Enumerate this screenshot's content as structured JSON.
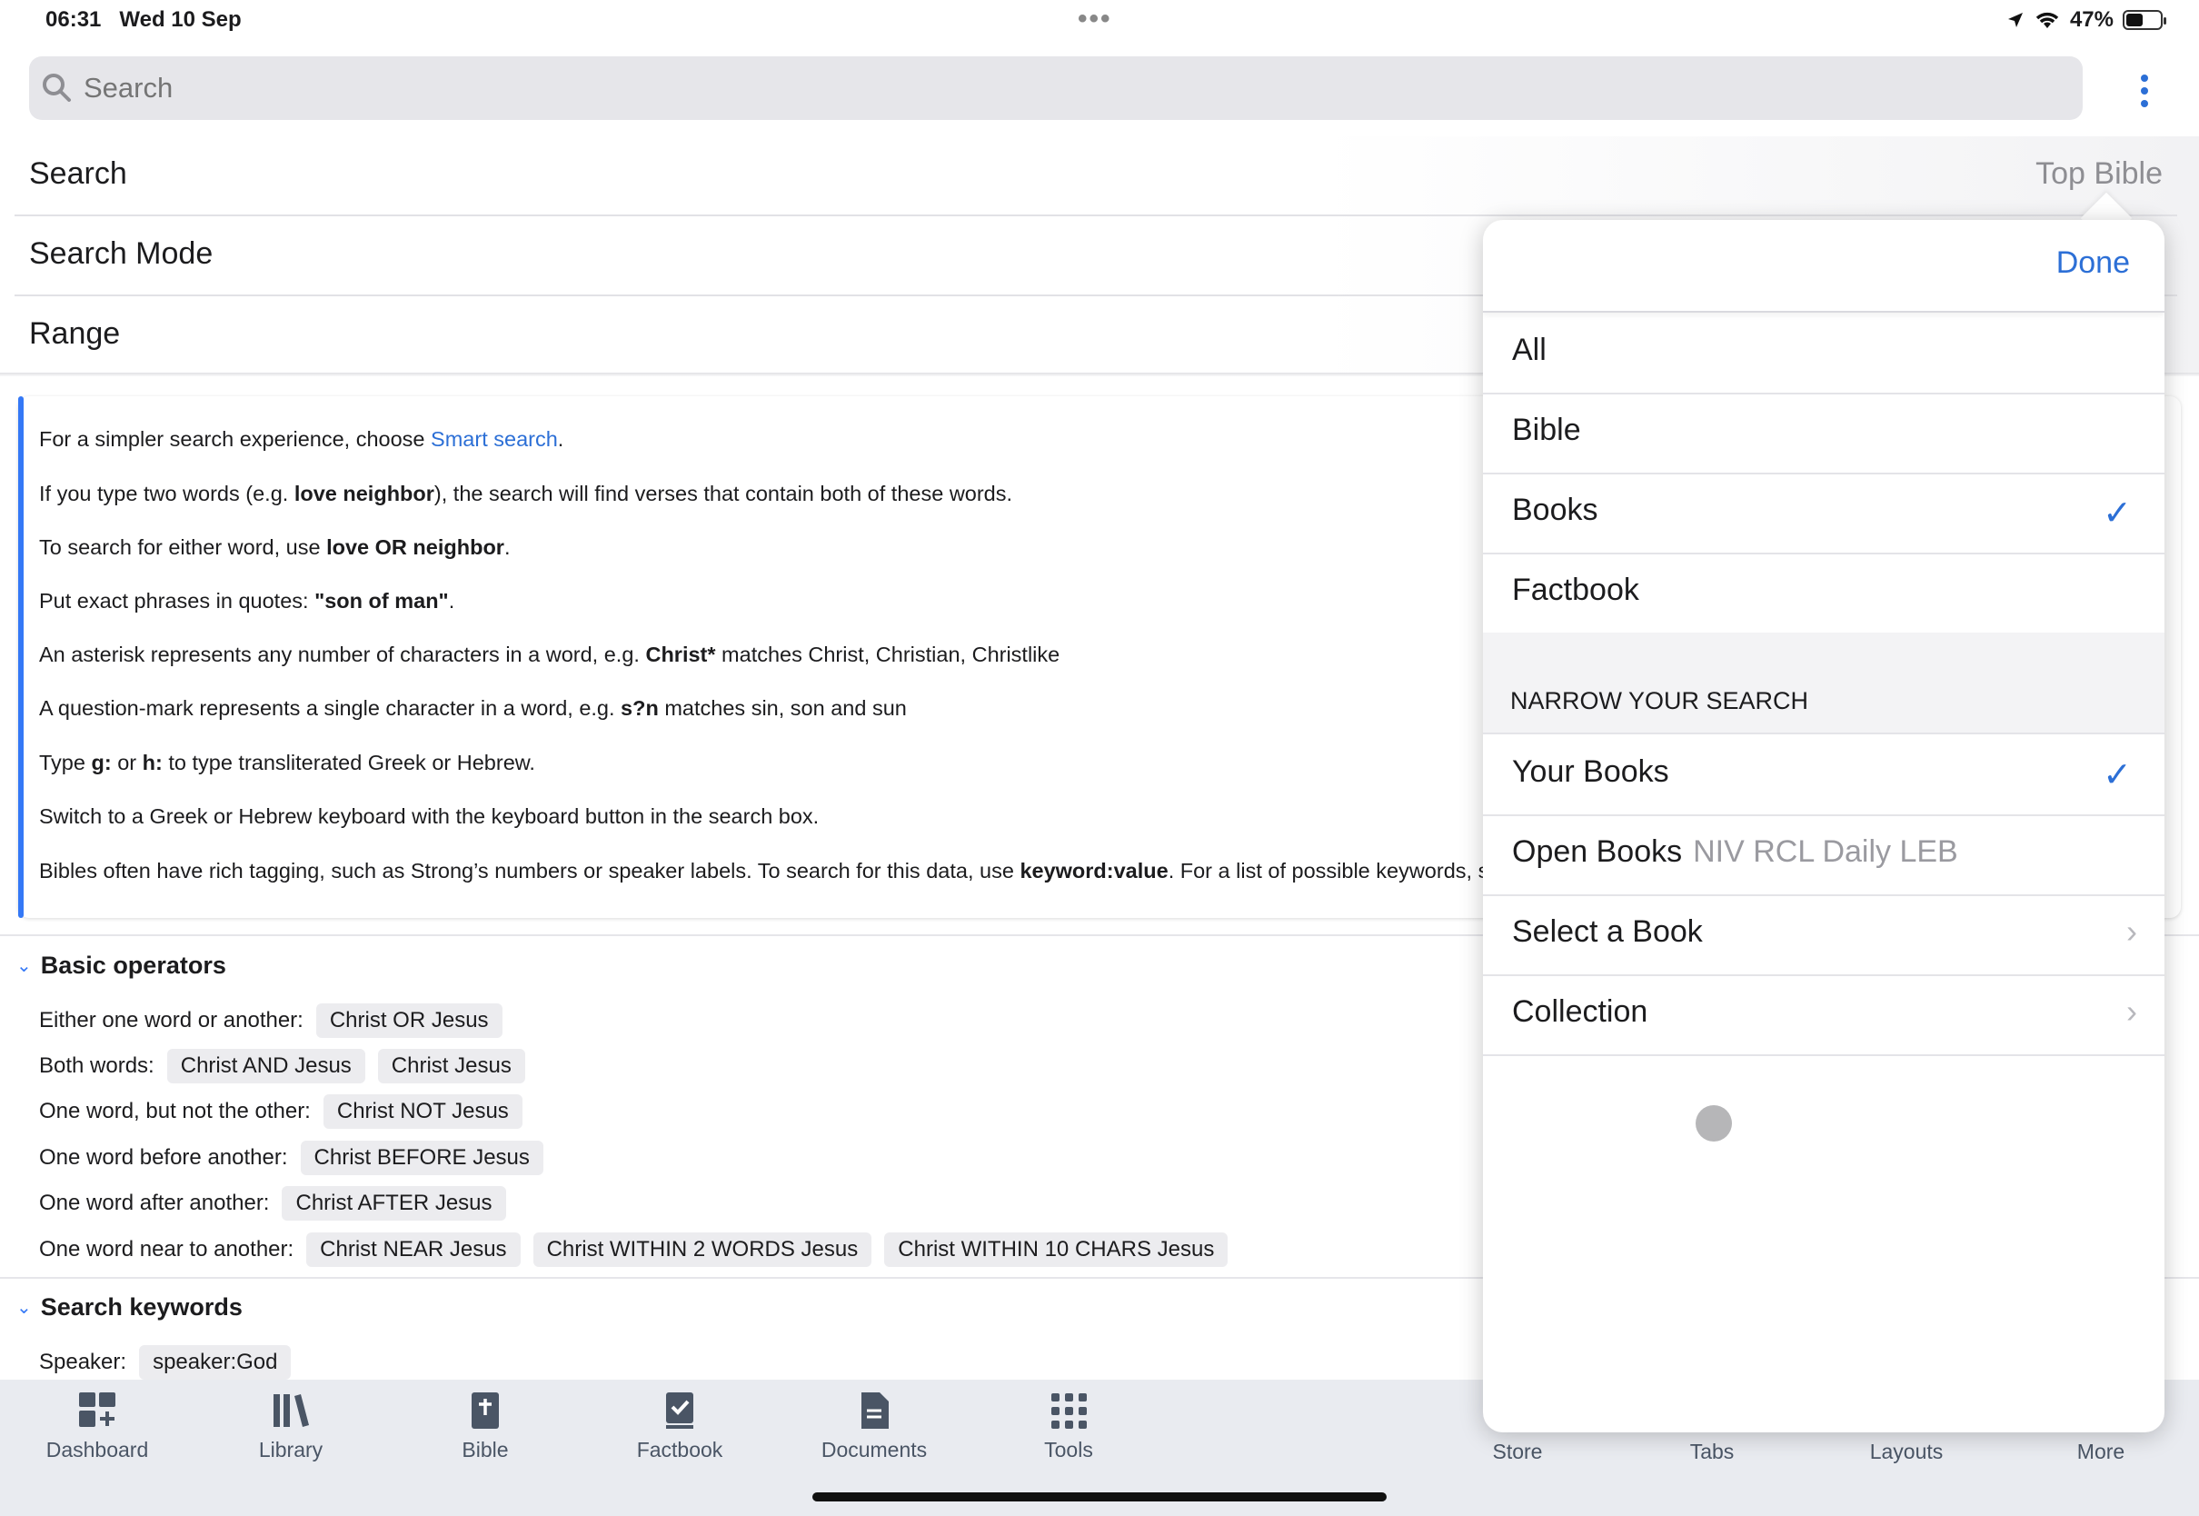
{
  "status": {
    "time": "06:31",
    "date": "Wed 10 Sep",
    "battery": "47%"
  },
  "search": {
    "placeholder": "Search"
  },
  "rows": [
    {
      "label": "Search",
      "value": "Top Bible"
    },
    {
      "label": "Search Mode",
      "value": ""
    },
    {
      "label": "Range",
      "value": ""
    }
  ],
  "help": {
    "line1_a": "For a simpler search experience, choose ",
    "line1_link": "Smart search",
    "line1_b": ".",
    "line2_a": "If you type two words (e.g. ",
    "line2_b": "love neighbor",
    "line2_c": "), the search will find verses that contain both of these words.",
    "line3_a": "To search for either word, use ",
    "line3_b": "love OR neighbor",
    "line3_c": ".",
    "line4_a": "Put exact phrases in quotes: ",
    "line4_b": "\"son of man\"",
    "line4_c": ".",
    "line5_a": "An asterisk represents any number of characters in a word, e.g. ",
    "line5_b": "Christ*",
    "line5_c": " matches Christ, Christian, Christlike",
    "line6_a": "A question-mark represents a single character in a word, e.g. ",
    "line6_b": "s?n",
    "line6_c": " matches sin, son and sun",
    "line7_a": "Type ",
    "line7_b": "g:",
    "line7_c": " or ",
    "line7_d": "h:",
    "line7_e": " to type transliterated Greek or Hebrew.",
    "line8": "Switch to a Greek or Hebrew keyboard with the keyboard button in the search box.",
    "line9_a": "Bibles often have rich tagging, such as Strong’s numbers or speaker labels. To search for this data, use ",
    "line9_b": "keyword:value",
    "line9_c": ". For a list of possible keywords, se"
  },
  "basic": {
    "title": "Basic operators",
    "rows": [
      {
        "label": "Either one word or another:",
        "chips": [
          "Christ OR Jesus"
        ]
      },
      {
        "label": "Both words:",
        "chips": [
          "Christ AND Jesus",
          "Christ Jesus"
        ]
      },
      {
        "label": "One word, but not the other:",
        "chips": [
          "Christ NOT Jesus"
        ]
      },
      {
        "label": "One word before another:",
        "chips": [
          "Christ BEFORE Jesus"
        ]
      },
      {
        "label": "One word after another:",
        "chips": [
          "Christ AFTER Jesus"
        ]
      },
      {
        "label": "One word near to another:",
        "chips": [
          "Christ NEAR Jesus",
          "Christ WITHIN 2 WORDS Jesus",
          "Christ WITHIN 10 CHARS Jesus"
        ]
      }
    ]
  },
  "keywords": {
    "title": "Search keywords",
    "speaker_label": "Speaker:",
    "speaker_chip": "speaker:God"
  },
  "tabs": [
    "Dashboard",
    "Library",
    "Bible",
    "Factbook",
    "Documents",
    "Tools",
    "Store",
    "Tabs",
    "Layouts",
    "More"
  ],
  "popover": {
    "done": "Done",
    "options": [
      "All",
      "Bible",
      "Books",
      "Factbook"
    ],
    "selected_option": "Books",
    "narrow_header": "NARROW YOUR SEARCH",
    "narrow": {
      "your_books": "Your Books",
      "open_books": "Open Books",
      "open_books_list": "NIV RCL Daily LEB",
      "select_book": "Select a Book",
      "collection": "Collection"
    },
    "selected_narrow": "Your Books"
  },
  "colors": {
    "accent": "#2c6fd6",
    "tab_bar": "#e9ebf0",
    "chip": "#ececef"
  }
}
